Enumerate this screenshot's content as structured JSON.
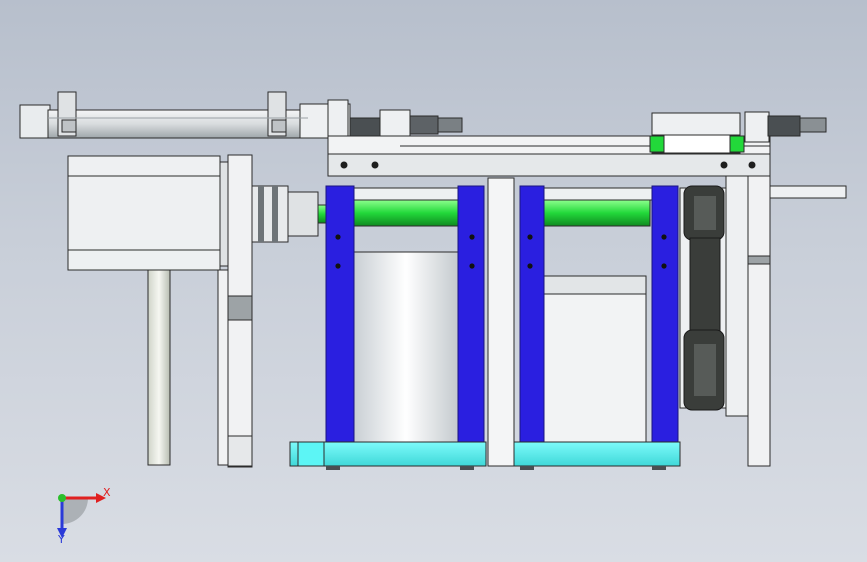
{
  "viewport": {
    "background_top": "#b7bfcc",
    "background_bottom": "#d9dde4"
  },
  "colors": {
    "blue_plate": "#2a1fe0",
    "green_roller": "#22d83a",
    "cyan_base": "#5cf5f5",
    "belt_dark": "#3a3d3a",
    "metal_light": "#eef0f2",
    "metal_mid": "#cfd3d6",
    "outline": "#2b2b2b"
  },
  "triad": {
    "x_label": "X",
    "y_label": "Y",
    "x_color": "#e02020",
    "y_color": "#2a3ad8",
    "origin_color": "#2bbf2b"
  }
}
